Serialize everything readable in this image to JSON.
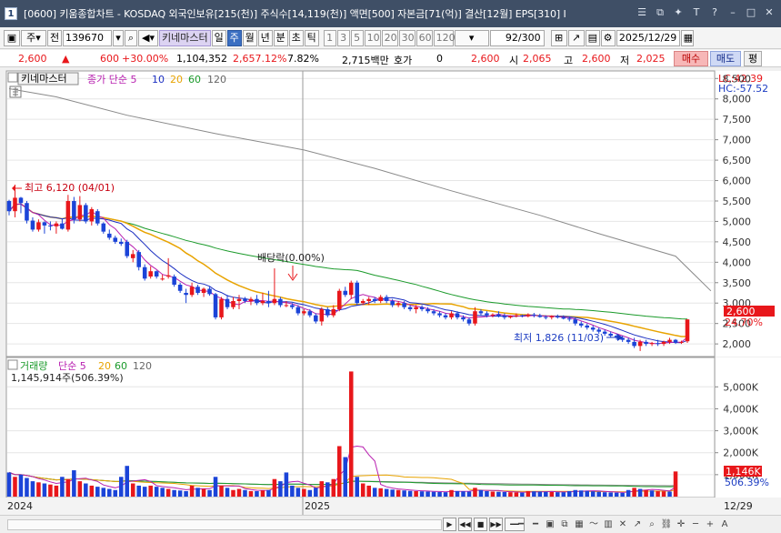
{
  "window": {
    "app_icon": "1",
    "title": "[0600] 키움종합차트 - KOSDAQ 외국인보유[215(천)] 주식수[14,119(천)] 액면[500] 자본금[71(억)] 결산[12월] EPS[310] I",
    "buttons": [
      "list-icon",
      "restore-icon",
      "pin-icon",
      "font-icon",
      "help-icon",
      "minimize-icon",
      "maximize-icon",
      "close-icon"
    ]
  },
  "toolbar": {
    "market": "주",
    "market_all": "전",
    "code": "139670",
    "kiwoom_master_label": "키네마스터",
    "periods": [
      "일",
      "주",
      "월",
      "년",
      "분",
      "초",
      "틱"
    ],
    "selected_period": "주",
    "intervals": [
      "1",
      "3",
      "5",
      "10",
      "20",
      "30",
      "60",
      "120"
    ],
    "page_counter": "92/300",
    "date": "2025/12/29"
  },
  "quote": {
    "price": "2,600",
    "change": "600",
    "change_rate": "+30.00%",
    "volume": "1,104,352",
    "volume_rate": "2,657.12%",
    "turnover": "7.82%",
    "amount": "2,715백만",
    "hoga_label": "호가",
    "hoga_value": "0",
    "current": "2,600",
    "open_label": "시",
    "open": "2,065",
    "high_label": "고",
    "high": "2,600",
    "low_label": "저",
    "low": "2,025",
    "buy_label": "매수",
    "sell_label": "매도",
    "avg_label": "평"
  },
  "price_panel": {
    "stock_name": "키네마스터",
    "legend": [
      {
        "text": "종가 단순 5",
        "color": "#b820b0"
      },
      {
        "text": "10",
        "color": "#1b2fc2"
      },
      {
        "text": "20",
        "color": "#e8a300"
      },
      {
        "text": "60",
        "color": "#1a9a2a"
      },
      {
        "text": "120",
        "color": "#666666"
      }
    ],
    "lc": "LC:42.39",
    "hc": "HC:-57.52",
    "high_annotation": "최고 6,120 (04/01)",
    "low_annotation": "최저 1,826 (11/03)",
    "dividend_annotation": "배당락(0.00%)",
    "last_price_tag": "2,600",
    "last_change_tag": "24.70%"
  },
  "volume_panel": {
    "legend_title": "거래량",
    "legend": [
      {
        "text": "단순 5",
        "color": "#b820b0"
      },
      {
        "text": "20",
        "color": "#e8a300"
      },
      {
        "text": "60",
        "color": "#1a9a2a"
      },
      {
        "text": "120",
        "color": "#666666"
      }
    ],
    "summary": "1,145,914주(506.39%)",
    "last_volume_tag": "1,146K",
    "last_rate_tag": "506.39%"
  },
  "x_axis": {
    "labels": [
      "2024",
      "2025"
    ],
    "right_label": "12/29"
  },
  "chart_data": [
    {
      "type": "candlestick",
      "title": "키네마스터",
      "x_start": "2024",
      "x_end": "12/29",
      "y_ticks": [
        "2,000",
        "2,500",
        "3,000",
        "3,500",
        "4,000",
        "4,500",
        "5,000",
        "5,500",
        "6,000",
        "6,500",
        "7,000",
        "7,500",
        "8,000",
        "8,500"
      ],
      "ylim": [
        1780,
        8640
      ],
      "candles": [
        [
          5500,
          5530,
          5150,
          5250
        ],
        [
          5250,
          5900,
          5100,
          5580
        ],
        [
          5580,
          5600,
          5200,
          5450
        ],
        [
          5450,
          5500,
          4950,
          5020
        ],
        [
          5020,
          5100,
          4750,
          4800
        ],
        [
          4800,
          5050,
          4750,
          4980
        ],
        [
          4980,
          5000,
          4700,
          4900
        ],
        [
          4900,
          5000,
          4780,
          4880
        ],
        [
          4880,
          5000,
          4700,
          4950
        ],
        [
          4950,
          5080,
          4800,
          4820
        ],
        [
          4800,
          5650,
          4750,
          5500
        ],
        [
          5500,
          5600,
          4950,
          5050
        ],
        [
          5050,
          5620,
          5000,
          5400
        ],
        [
          5400,
          5450,
          4950,
          5000
        ],
        [
          5000,
          5350,
          4900,
          5300
        ],
        [
          5250,
          5300,
          4900,
          4950
        ],
        [
          4950,
          4980,
          4700,
          4750
        ],
        [
          4700,
          4800,
          4550,
          4600
        ],
        [
          4600,
          4650,
          4450,
          4500
        ],
        [
          4500,
          4580,
          4400,
          4450
        ],
        [
          4500,
          4550,
          4100,
          4150
        ],
        [
          4100,
          4300,
          4000,
          4200
        ],
        [
          4250,
          4300,
          3800,
          3880
        ],
        [
          3880,
          3950,
          3550,
          3600
        ],
        [
          3650,
          3900,
          3600,
          3780
        ],
        [
          3780,
          3800,
          3600,
          3650
        ],
        [
          3600,
          3700,
          3550,
          3600
        ],
        [
          3650,
          4100,
          3600,
          3680
        ],
        [
          3650,
          3700,
          3400,
          3450
        ],
        [
          3450,
          3500,
          3250,
          3300
        ],
        [
          3250,
          3350,
          3000,
          3200
        ],
        [
          3200,
          3500,
          3150,
          3400
        ],
        [
          3400,
          3450,
          3200,
          3250
        ],
        [
          3250,
          3380,
          3150,
          3350
        ],
        [
          3350,
          3400,
          3180,
          3220
        ],
        [
          3220,
          3250,
          2600,
          2650
        ],
        [
          2650,
          3150,
          2600,
          3100
        ],
        [
          3100,
          3200,
          2850,
          2900
        ],
        [
          2900,
          3150,
          2850,
          3050
        ],
        [
          3050,
          3200,
          2850,
          3100
        ],
        [
          3100,
          3150,
          3000,
          3050
        ],
        [
          3050,
          3150,
          2950,
          3100
        ],
        [
          3100,
          3200,
          2950,
          3000
        ],
        [
          3000,
          3250,
          2950,
          3050
        ],
        [
          3050,
          3300,
          2900,
          3000
        ],
        [
          3000,
          3850,
          2950,
          3100
        ],
        [
          3100,
          3150,
          2900,
          2950
        ],
        [
          2950,
          3050,
          2900,
          2950
        ],
        [
          2950,
          3000,
          2850,
          2900
        ],
        [
          2900,
          2950,
          2700,
          2750
        ],
        [
          2750,
          2850,
          2700,
          2800
        ],
        [
          2800,
          2850,
          2650,
          2700
        ],
        [
          2700,
          2750,
          2500,
          2550
        ],
        [
          2550,
          2900,
          2450,
          2850
        ],
        [
          2850,
          2900,
          2650,
          2700
        ],
        [
          2700,
          2950,
          2650,
          2850
        ],
        [
          2850,
          3350,
          2800,
          3300
        ],
        [
          3300,
          3400,
          3150,
          3200
        ],
        [
          3200,
          3550,
          3100,
          3500
        ],
        [
          3500,
          3550,
          2950,
          3000
        ],
        [
          3000,
          3100,
          2950,
          3050
        ],
        [
          3050,
          3150,
          2950,
          3100
        ],
        [
          3100,
          3150,
          3000,
          3050
        ],
        [
          3050,
          3200,
          3000,
          3150
        ],
        [
          3150,
          3200,
          3000,
          3050
        ],
        [
          3050,
          3100,
          2900,
          2950
        ],
        [
          2950,
          3050,
          2900,
          3000
        ],
        [
          3000,
          3050,
          2850,
          2900
        ],
        [
          2900,
          2950,
          2800,
          2850
        ],
        [
          2850,
          2950,
          2750,
          2900
        ],
        [
          2900,
          2950,
          2800,
          2850
        ],
        [
          2850,
          2900,
          2750,
          2800
        ],
        [
          2800,
          2850,
          2700,
          2750
        ],
        [
          2750,
          2800,
          2650,
          2700
        ],
        [
          2700,
          2750,
          2600,
          2650
        ],
        [
          2650,
          2800,
          2600,
          2750
        ],
        [
          2750,
          2800,
          2600,
          2650
        ],
        [
          2650,
          2700,
          2550,
          2600
        ],
        [
          2600,
          2650,
          2450,
          2500
        ],
        [
          2500,
          2900,
          2450,
          2800
        ],
        [
          2800,
          2850,
          2700,
          2750
        ],
        [
          2750,
          2800,
          2650,
          2700
        ],
        [
          2700,
          2750,
          2650,
          2720
        ],
        [
          2720,
          2800,
          2650,
          2680
        ],
        [
          2680,
          2750,
          2600,
          2650
        ],
        [
          2650,
          2700,
          2620,
          2680
        ],
        [
          2680,
          2750,
          2650,
          2700
        ],
        [
          2700,
          2720,
          2650,
          2680
        ],
        [
          2680,
          2750,
          2650,
          2720
        ],
        [
          2720,
          2760,
          2650,
          2700
        ],
        [
          2700,
          2740,
          2640,
          2660
        ],
        [
          2660,
          2700,
          2600,
          2650
        ],
        [
          2650,
          2700,
          2600,
          2680
        ],
        [
          2680,
          2720,
          2620,
          2650
        ],
        [
          2650,
          2700,
          2600,
          2620
        ],
        [
          2620,
          2680,
          2550,
          2600
        ],
        [
          2600,
          2650,
          2450,
          2500
        ],
        [
          2500,
          2550,
          2400,
          2450
        ],
        [
          2450,
          2500,
          2350,
          2400
        ],
        [
          2400,
          2450,
          2300,
          2350
        ],
        [
          2350,
          2400,
          2250,
          2300
        ],
        [
          2300,
          2350,
          2200,
          2250
        ],
        [
          2250,
          2300,
          2150,
          2200
        ],
        [
          2200,
          2250,
          2100,
          2150
        ],
        [
          2150,
          2200,
          2050,
          2100
        ],
        [
          2100,
          2150,
          2000,
          2050
        ],
        [
          2050,
          2150,
          1900,
          1950
        ],
        [
          1950,
          2100,
          1826,
          2050
        ],
        [
          2050,
          2100,
          1950,
          2000
        ],
        [
          2000,
          2050,
          1950,
          2020
        ],
        [
          2020,
          2100,
          1950,
          2000
        ],
        [
          2000,
          2080,
          1950,
          2050
        ],
        [
          2050,
          2150,
          2000,
          2100
        ],
        [
          2100,
          2120,
          2000,
          2030
        ],
        [
          2030,
          2080,
          2000,
          2050
        ],
        [
          2065,
          2600,
          2025,
          2600
        ]
      ],
      "ma120": [
        [
          0,
          8250
        ],
        [
          8,
          8050
        ],
        [
          20,
          7600
        ],
        [
          35,
          7150
        ],
        [
          50,
          6750
        ],
        [
          62,
          6300
        ],
        [
          75,
          5750
        ],
        [
          90,
          5150
        ],
        [
          100,
          4700
        ],
        [
          113,
          4150
        ],
        [
          119,
          3300
        ]
      ]
    },
    {
      "type": "bar",
      "title": "거래량",
      "y_ticks": [
        "1,000K",
        "2,000K",
        "3,000K",
        "4,000K",
        "5,000K"
      ],
      "ylim": [
        0,
        5800
      ],
      "values": [
        1100,
        900,
        1000,
        850,
        700,
        650,
        600,
        550,
        500,
        900,
        800,
        1200,
        700,
        600,
        500,
        450,
        400,
        350,
        300,
        900,
        1400,
        600,
        500,
        450,
        500,
        450,
        400,
        350,
        300,
        280,
        250,
        500,
        400,
        350,
        300,
        900,
        500,
        400,
        300,
        350,
        300,
        250,
        250,
        280,
        300,
        800,
        700,
        1100,
        500,
        400,
        350,
        300,
        400,
        700,
        650,
        800,
        2300,
        1800,
        5700,
        900,
        600,
        500,
        400,
        380,
        350,
        320,
        300,
        280,
        260,
        250,
        240,
        230,
        220,
        210,
        200,
        300,
        250,
        240,
        230,
        400,
        300,
        250,
        230,
        220,
        210,
        200,
        190,
        180,
        250,
        240,
        230,
        220,
        210,
        200,
        200,
        250,
        300,
        280,
        260,
        240,
        220,
        200,
        190,
        180,
        170,
        300,
        400,
        350,
        300,
        280,
        250,
        240,
        230,
        1146
      ],
      "up": [
        false,
        true,
        false,
        false,
        false,
        true,
        false,
        true,
        true,
        false,
        true,
        false,
        true,
        false,
        true,
        false,
        false,
        false,
        false,
        false,
        false,
        true,
        false,
        false,
        true,
        false,
        false,
        true,
        false,
        false,
        false,
        true,
        false,
        true,
        false,
        false,
        true,
        false,
        true,
        true,
        false,
        true,
        false,
        true,
        false,
        true,
        false,
        false,
        false,
        false,
        true,
        false,
        false,
        true,
        false,
        true,
        true,
        false,
        true,
        false,
        true,
        true,
        false,
        true,
        false,
        false,
        true,
        false,
        false,
        true,
        false,
        false,
        false,
        false,
        false,
        true,
        false,
        false,
        false,
        true,
        false,
        false,
        true,
        false,
        false,
        true,
        true,
        false,
        true,
        false,
        false,
        false,
        true,
        false,
        false,
        false,
        false,
        false,
        false,
        false,
        false,
        false,
        false,
        false,
        false,
        false,
        true,
        false,
        true,
        false,
        true,
        true,
        false,
        true,
        true
      ]
    }
  ]
}
